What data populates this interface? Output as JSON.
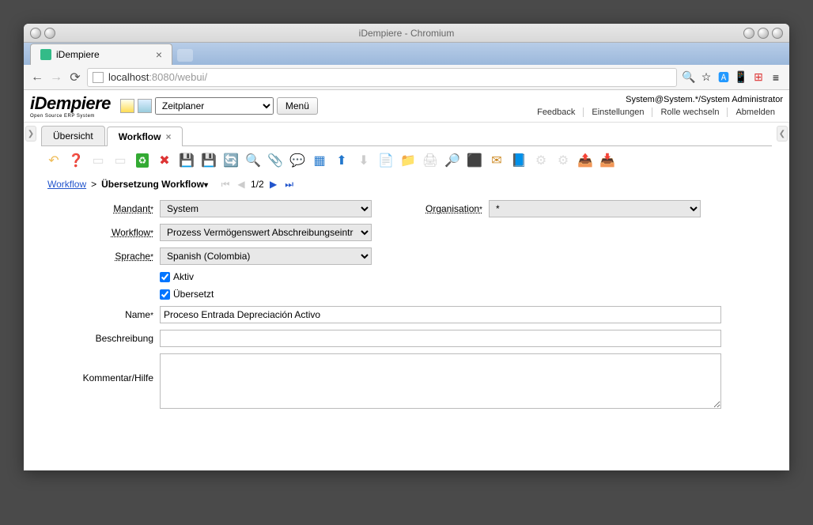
{
  "window": {
    "title": "iDempiere - Chromium"
  },
  "browserTab": {
    "label": "iDempiere"
  },
  "url": {
    "host": "localhost",
    "port": ":8080",
    "path": "/webui/"
  },
  "app": {
    "logo": "iDempiere",
    "logoSub": "Open Source ERP System",
    "menuSelect": "Zeitplaner",
    "menuButton": "Menü",
    "sysInfo": "System@System.*/System Administrator",
    "links": {
      "feedback": "Feedback",
      "settings": "Einstellungen",
      "role": "Rolle wechseln",
      "logout": "Abmelden"
    }
  },
  "tabs": {
    "overview": "Übersicht",
    "workflow": "Workflow"
  },
  "breadcrumb": {
    "root": "Workflow",
    "current": "Übersetzung Workflow",
    "page": "1/2"
  },
  "form": {
    "mandant": {
      "label": "Mandant",
      "value": "System"
    },
    "organisation": {
      "label": "Organisation",
      "value": "*"
    },
    "workflow": {
      "label": "Workflow",
      "value": "Prozess Vermögenswert Abschreibungseintr"
    },
    "sprache": {
      "label": "Sprache",
      "value": "Spanish (Colombia)"
    },
    "aktiv": {
      "label": "Aktiv",
      "checked": true
    },
    "uebersetzt": {
      "label": "Übersetzt",
      "checked": true
    },
    "name": {
      "label": "Name",
      "value": "Proceso Entrada Depreciación Activo"
    },
    "beschreibung": {
      "label": "Beschreibung",
      "value": ""
    },
    "kommentar": {
      "label": "Kommentar/Hilfe",
      "value": ""
    }
  }
}
